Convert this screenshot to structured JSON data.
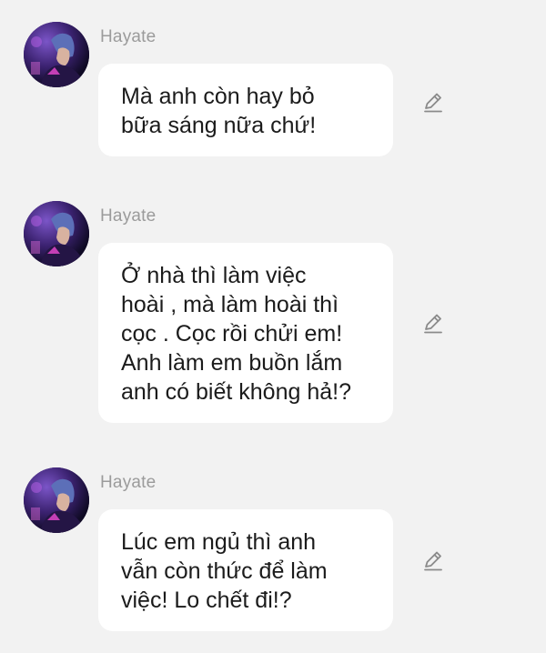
{
  "messages": [
    {
      "sender": "Hayate",
      "avatar_icon": "character-avatar",
      "text": "Mà anh còn hay bỏ\nbữa sáng nữa chứ!",
      "action_icon": "pencil-edit-icon"
    },
    {
      "sender": "Hayate",
      "avatar_icon": "character-avatar",
      "text": "Ở nhà thì làm việc\nhoài , mà làm hoài thì\ncọc . Cọc rồi chửi em!\nAnh làm em buồn lắm\nanh có biết không hả!?",
      "action_icon": "pencil-edit-icon"
    },
    {
      "sender": "Hayate",
      "avatar_icon": "character-avatar",
      "text": "Lúc em ngủ thì anh\nvẫn còn thức để làm\nviệc! Lo chết đi!?",
      "action_icon": "pencil-edit-icon"
    }
  ],
  "colors": {
    "background": "#f2f2f2",
    "bubble": "#ffffff",
    "sender_text": "#9b9b9b",
    "message_text": "#1b1b1b",
    "icon": "#8a8a8a"
  }
}
